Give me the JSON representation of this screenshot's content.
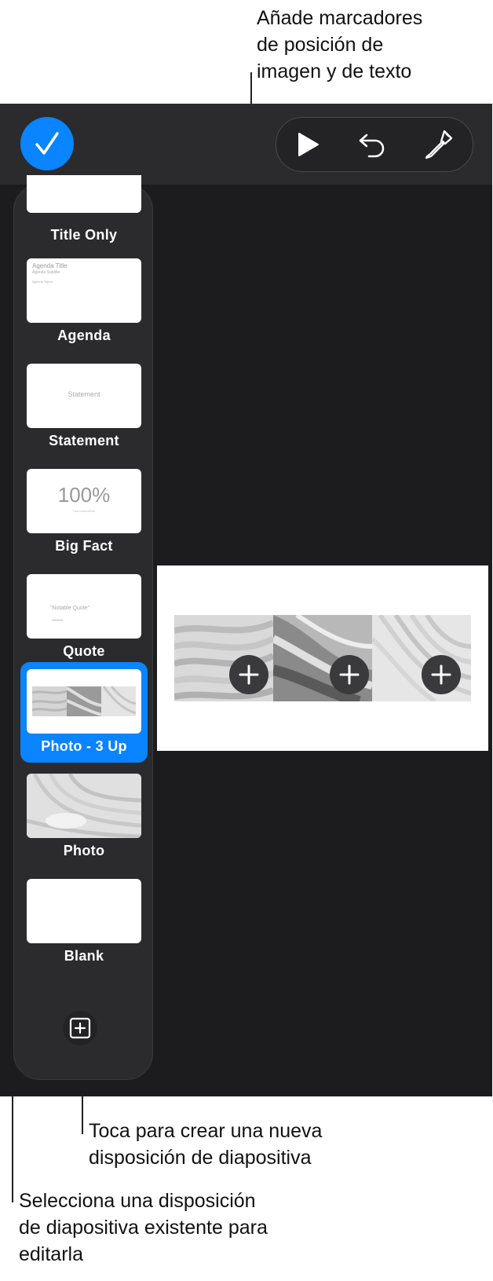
{
  "callouts": {
    "top": "Añade marcadores\nde posición de\nimagen y de texto",
    "new_layout": "Toca para crear una nueva\ndisposición de diapositiva",
    "select_layout": "Selecciona una disposición\nde diapositiva existente para\neditarla"
  },
  "toolbar": {
    "done_icon": "checkmark-icon",
    "play_icon": "play-icon",
    "undo_icon": "undo-icon",
    "format_icon": "paintbrush-icon"
  },
  "layouts": [
    {
      "label": "Title Only"
    },
    {
      "label": "Agenda",
      "thumb_title": "Agenda Title",
      "thumb_sub": "Agenda Subtitle",
      "thumb_body": "Agenda Topics"
    },
    {
      "label": "Statement",
      "thumb_text": "Statement"
    },
    {
      "label": "Big Fact",
      "thumb_big": "100%",
      "thumb_small": "Fact information"
    },
    {
      "label": "Quote",
      "thumb_text": "\"Notable Quote\""
    },
    {
      "label": "Photo - 3 Up",
      "selected": true
    },
    {
      "label": "Photo"
    },
    {
      "label": "Blank"
    }
  ],
  "add_layout_icon": "add-layout-icon",
  "colors": {
    "accent": "#0a84ff",
    "panel": "#2b2b2e",
    "background": "#1c1c1e"
  }
}
